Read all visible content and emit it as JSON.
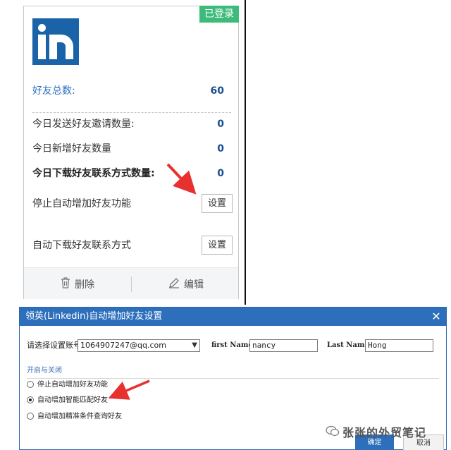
{
  "card": {
    "badge": "已登录",
    "stats": [
      {
        "label": "好友总数:",
        "value": "60"
      },
      {
        "label": "今日发送好友邀请数量:",
        "value": "0"
      },
      {
        "label": "今日新增好友数量",
        "value": "0"
      },
      {
        "label": "今日下载好友联系方式数量:",
        "value": "0"
      }
    ],
    "settings": [
      {
        "label": "停止自动增加好友功能",
        "button": "设置"
      },
      {
        "label": "自动下载好友联系方式",
        "button": "设置"
      }
    ],
    "footer": {
      "delete_label": "删除",
      "edit_label": "编辑"
    }
  },
  "dialog": {
    "title": "领英(Linkedin)自动增加好友设置",
    "account_label": "请选择设置账号:",
    "account_value": "1064907247@qq.com",
    "first_name_label": "first Name:",
    "first_name_value": "nancy",
    "last_name_label": "Last Name:",
    "last_name_value": "Hong",
    "group_label": "开启与关闭",
    "options": [
      {
        "label": "停止自动增加好友功能",
        "selected": false
      },
      {
        "label": "自动增加智能匹配好友",
        "selected": true
      },
      {
        "label": "自动增加精准条件查询好友",
        "selected": false
      }
    ],
    "ok_label": "确定",
    "cancel_label": "取消"
  },
  "watermark": "张张的外贸笔记",
  "colors": {
    "badge_green": "#3dbb7a",
    "linkedin_blue": "#1a63a8",
    "title_blue": "#2d6fbb",
    "arrow_red": "#e8312f"
  }
}
